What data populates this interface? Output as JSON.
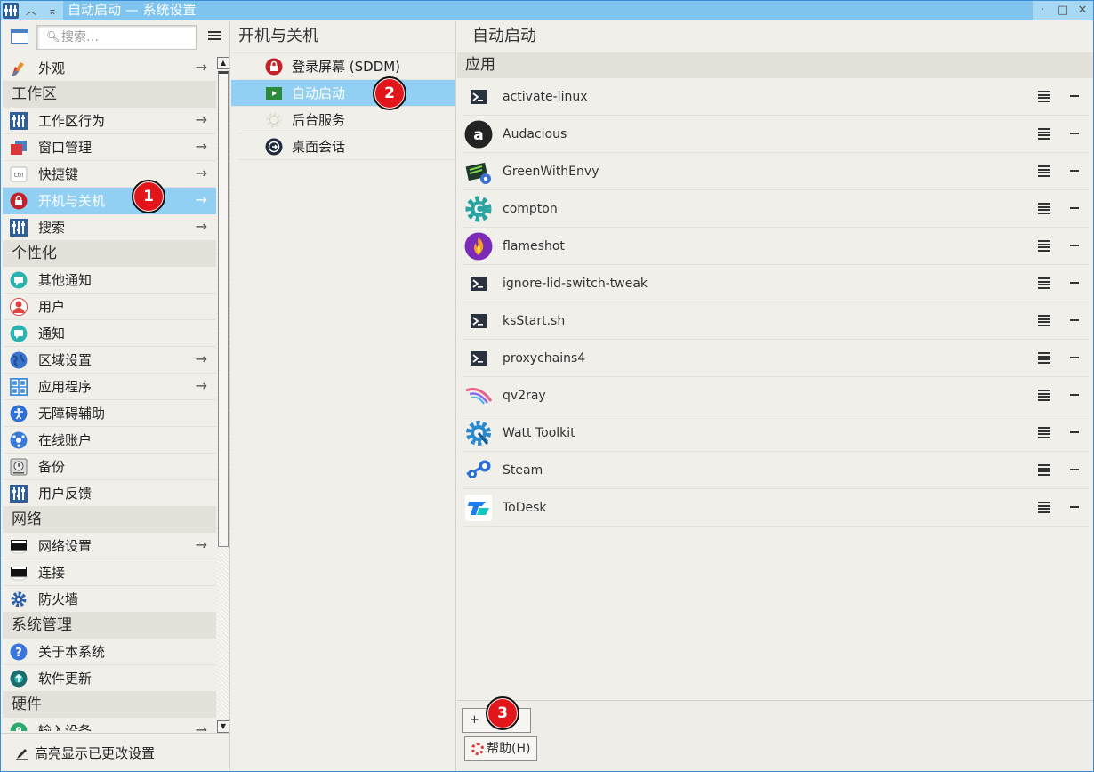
{
  "window": {
    "title": "自动启动 — 系统设置"
  },
  "sidebar": {
    "search_placeholder": "搜索…",
    "footer_label": "高亮显示已更改设置",
    "items": [
      {
        "kind": "item",
        "label": "外观",
        "icon": "appearance-brush-icon",
        "arrow": true
      },
      {
        "kind": "section",
        "label": "工作区"
      },
      {
        "kind": "item",
        "label": "工作区行为",
        "icon": "sliders-icon",
        "arrow": true
      },
      {
        "kind": "item",
        "label": "窗口管理",
        "icon": "window-icon",
        "arrow": true
      },
      {
        "kind": "item",
        "label": "快捷键",
        "icon": "keyboard-ctrl-icon",
        "arrow": true
      },
      {
        "kind": "item",
        "label": "开机与关机",
        "icon": "power-lock-icon",
        "arrow": true,
        "active": true
      },
      {
        "kind": "item",
        "label": "搜索",
        "icon": "sliders-icon",
        "arrow": true
      },
      {
        "kind": "section",
        "label": "个性化"
      },
      {
        "kind": "item",
        "label": "其他通知",
        "icon": "chat-bubble-icon",
        "arrow": false
      },
      {
        "kind": "item",
        "label": "用户",
        "icon": "user-icon",
        "arrow": false
      },
      {
        "kind": "item",
        "label": "通知",
        "icon": "chat-bubble-icon",
        "arrow": false
      },
      {
        "kind": "item",
        "label": "区域设置",
        "icon": "globe-icon",
        "arrow": true
      },
      {
        "kind": "item",
        "label": "应用程序",
        "icon": "apps-grid-icon",
        "arrow": true
      },
      {
        "kind": "item",
        "label": "无障碍辅助",
        "icon": "accessibility-icon",
        "arrow": false
      },
      {
        "kind": "item",
        "label": "在线账户",
        "icon": "online-accounts-icon",
        "arrow": false
      },
      {
        "kind": "item",
        "label": "备份",
        "icon": "backup-drive-icon",
        "arrow": false
      },
      {
        "kind": "item",
        "label": "用户反馈",
        "icon": "sliders-icon",
        "arrow": false
      },
      {
        "kind": "section",
        "label": "网络"
      },
      {
        "kind": "item",
        "label": "网络设置",
        "icon": "network-card-icon",
        "arrow": true
      },
      {
        "kind": "item",
        "label": "连接",
        "icon": "network-card-icon",
        "arrow": false
      },
      {
        "kind": "item",
        "label": "防火墙",
        "icon": "firewall-gear-icon",
        "arrow": false
      },
      {
        "kind": "section",
        "label": "系统管理"
      },
      {
        "kind": "item",
        "label": "关于本系统",
        "icon": "help-question-icon",
        "arrow": false
      },
      {
        "kind": "item",
        "label": "软件更新",
        "icon": "update-icon",
        "arrow": false
      },
      {
        "kind": "section",
        "label": "硬件"
      },
      {
        "kind": "item",
        "label": "输入设备",
        "icon": "mouse-icon",
        "arrow": true
      }
    ]
  },
  "middle": {
    "title": "开机与关机",
    "items": [
      {
        "label": "登录屏幕 (SDDM)",
        "icon": "lock-icon"
      },
      {
        "label": "自动启动",
        "icon": "autostart-play-icon",
        "active": true
      },
      {
        "label": "后台服务",
        "icon": "services-gear-icon"
      },
      {
        "label": "桌面会话",
        "icon": "session-icon"
      }
    ]
  },
  "main": {
    "title": "自动启动",
    "section_label": "应用",
    "apps": [
      {
        "name": "activate-linux",
        "icon": "terminal-icon"
      },
      {
        "name": "Audacious",
        "icon": "audacious-icon"
      },
      {
        "name": "GreenWithEnvy",
        "icon": "greenwithenvy-icon"
      },
      {
        "name": "compton",
        "icon": "compton-gear-icon"
      },
      {
        "name": "flameshot",
        "icon": "flameshot-icon"
      },
      {
        "name": "ignore-lid-switch-tweak",
        "icon": "terminal-icon"
      },
      {
        "name": "ksStart.sh",
        "icon": "terminal-icon"
      },
      {
        "name": "proxychains4",
        "icon": "terminal-icon"
      },
      {
        "name": "qv2ray",
        "icon": "qv2ray-icon"
      },
      {
        "name": "Watt Toolkit",
        "icon": "watt-toolkit-icon"
      },
      {
        "name": "Steam",
        "icon": "steam-icon"
      },
      {
        "name": "ToDesk",
        "icon": "todesk-icon"
      }
    ],
    "add_label": "+",
    "help_label": "帮助(H)"
  },
  "badges": [
    "1",
    "2",
    "3"
  ],
  "colors": {
    "accent": "#92d0f3",
    "title_bar": "#7ec4ef",
    "badge": "#e2151b"
  }
}
